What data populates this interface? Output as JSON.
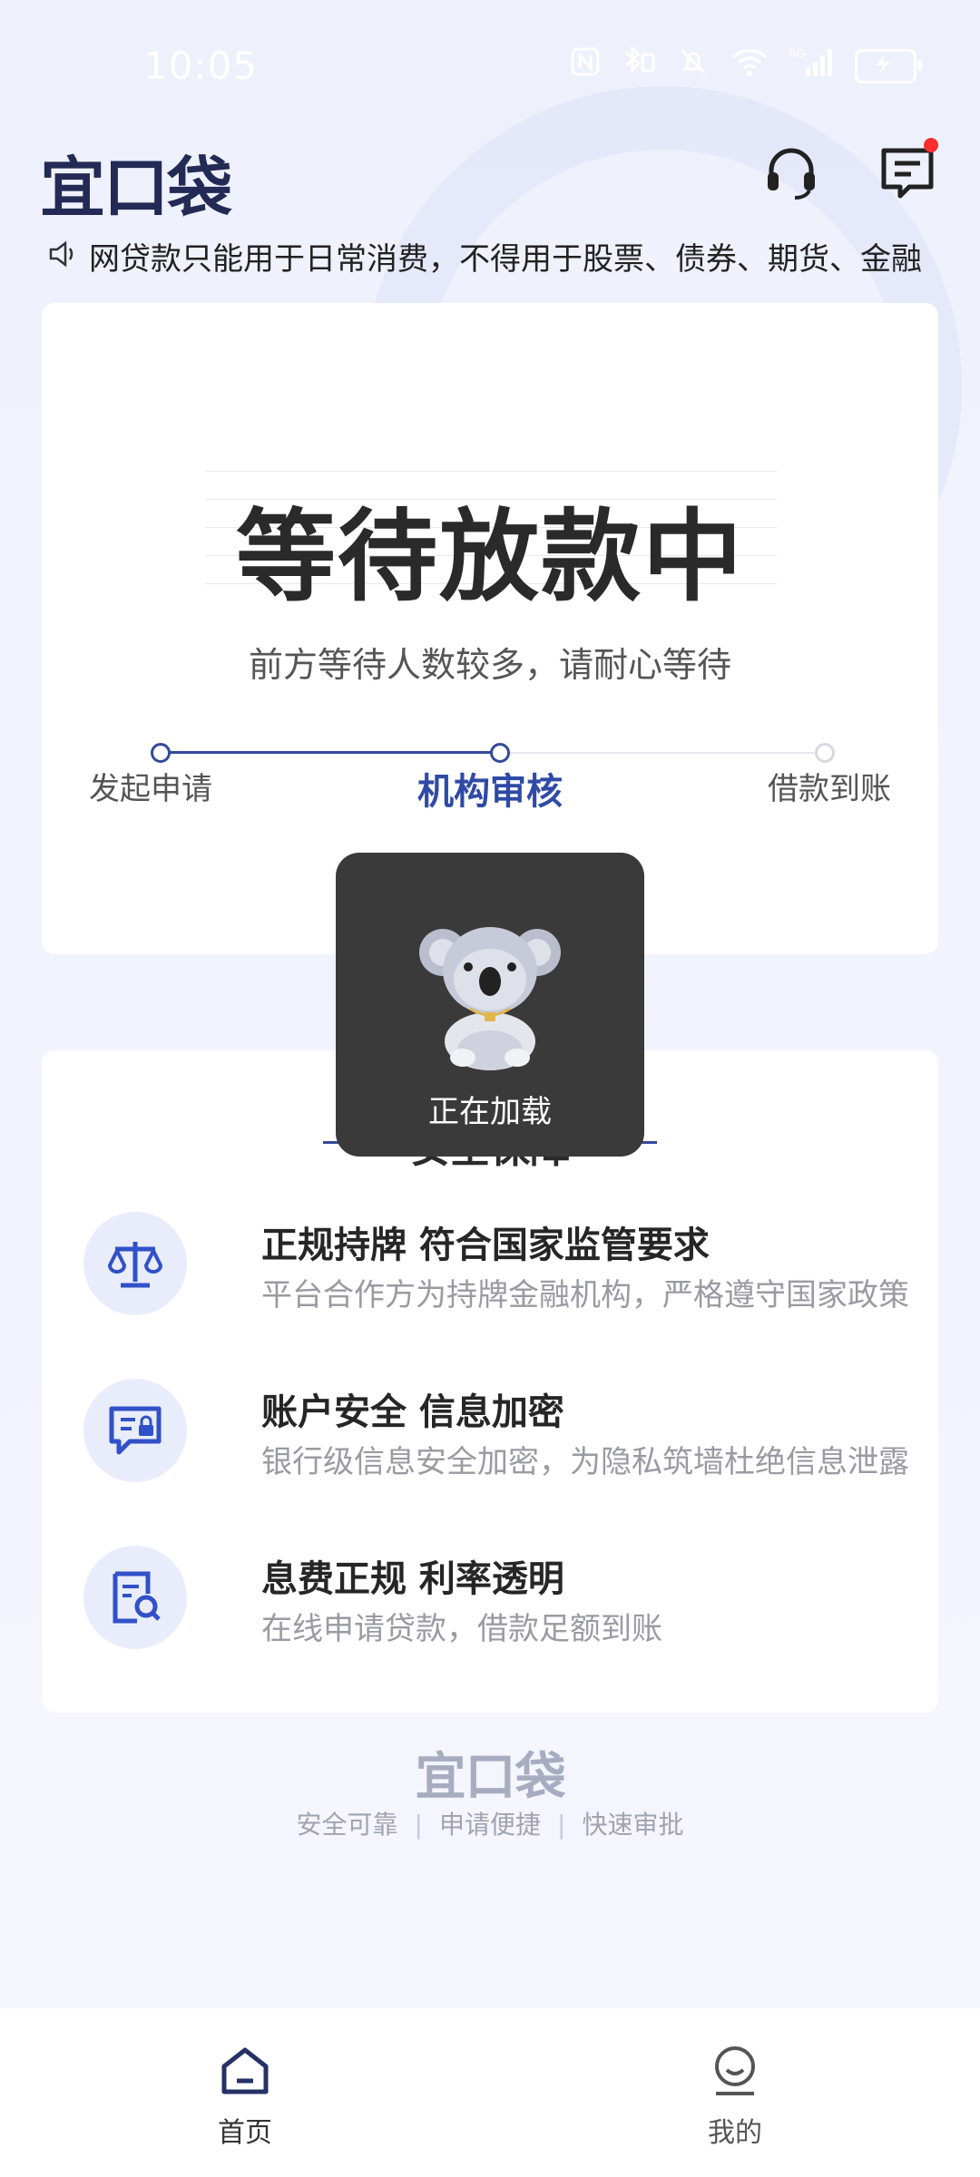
{
  "status_bar": {
    "time": "10:05",
    "icons": [
      "nfc-icon",
      "bluetooth-icon",
      "mute-icon",
      "wifi-icon",
      "5g-signal-icon",
      "battery-charging-icon"
    ]
  },
  "header": {
    "logo": "宜口袋",
    "icons": [
      "headset-icon",
      "message-icon"
    ],
    "message_badge_color": "#ff2d2d"
  },
  "notice": {
    "icon": "speaker-icon",
    "text": "网贷款只能用于日常消费，不得用于股票、债券、期货、金融"
  },
  "status_card": {
    "title": "等待放款中",
    "subtitle": "前方等待人数较多，请耐心等待",
    "steps": [
      {
        "label": "发起申请",
        "state": "done"
      },
      {
        "label": "机构审核",
        "state": "active"
      },
      {
        "label": "借款到账",
        "state": "pending"
      }
    ],
    "accent": "#2f4aa6"
  },
  "loading": {
    "text": "正在加载",
    "icon": "koala-mascot-icon"
  },
  "security": {
    "title": "安全保障",
    "features": [
      {
        "icon": "scale-icon",
        "title": "正规持牌 符合国家监管要求",
        "desc": "平台合作方为持牌金融机构，严格遵守国家政策"
      },
      {
        "icon": "secure-chat-icon",
        "title": "账户安全 信息加密",
        "desc": "银行级信息安全加密，为隐私筑墙杜绝信息泄露"
      },
      {
        "icon": "document-search-icon",
        "title": "息费正规  利率透明",
        "desc": "在线申请贷款，借款足额到账"
      }
    ]
  },
  "footer": {
    "logo": "宜口袋",
    "tags": [
      "安全可靠",
      "申请便捷",
      "快速审批"
    ]
  },
  "bottom_nav": {
    "items": [
      {
        "label": "首页",
        "icon": "home-icon",
        "active": true
      },
      {
        "label": "我的",
        "icon": "profile-icon",
        "active": false
      }
    ]
  }
}
